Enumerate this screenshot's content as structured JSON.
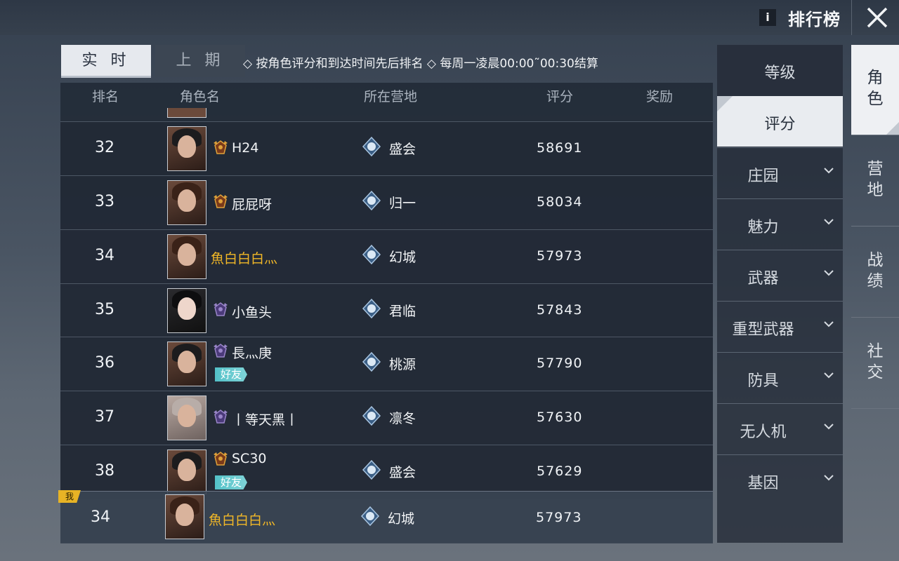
{
  "header": {
    "info_label": "i",
    "title": "排行榜",
    "close_icon": "close-icon"
  },
  "tabs": {
    "realtime": "实 时",
    "previous": "上 期"
  },
  "rule_text": "◇ 按角色评分和到达时间先后排名 ◇ 每周一凌晨00:00˜00:30结算",
  "table": {
    "columns": {
      "rank": "排名",
      "name": "角色名",
      "camp": "所在营地",
      "score": "评分",
      "reward": "奖励"
    },
    "rows": [
      {
        "rank": "32",
        "name": "H24",
        "name_color": "#f2f4f6",
        "camp": "盛会",
        "score": "58691",
        "friend": "",
        "badge": "gold-rank-badge-icon",
        "avatar": "male"
      },
      {
        "rank": "33",
        "name": "屁屁呀",
        "name_color": "#f2f4f6",
        "camp": "归一",
        "score": "58034",
        "friend": "",
        "badge": "gold-rank-badge-icon",
        "avatar": "female-brown"
      },
      {
        "rank": "34",
        "name": "魚白白白灬",
        "name_color": "#f2b827",
        "camp": "幻城",
        "score": "57973",
        "friend": "",
        "badge": "",
        "avatar": "female-brown"
      },
      {
        "rank": "35",
        "name": "小鱼头",
        "name_color": "#f2f4f6",
        "camp": "君临",
        "score": "57843",
        "friend": "",
        "badge": "purple-rank-badge-icon",
        "avatar": "female-dark"
      },
      {
        "rank": "36",
        "name": "長灬庚",
        "name_color": "#f2f4f6",
        "camp": "桃源",
        "score": "57790",
        "friend": "好友",
        "badge": "purple-wing-badge-icon",
        "avatar": "male"
      },
      {
        "rank": "37",
        "name": "丨等天黑丨",
        "name_color": "#f2f4f6",
        "camp": "凛冬",
        "score": "57630",
        "friend": "",
        "badge": "purple-wing-badge-icon",
        "avatar": "female-light"
      },
      {
        "rank": "38",
        "name": "SC30",
        "name_color": "#f2f4f6",
        "camp": "盛会",
        "score": "57629",
        "friend": "好友",
        "badge": "gold-rank-badge-icon",
        "avatar": "male"
      }
    ],
    "my_row": {
      "me_tag": "我",
      "rank": "34",
      "name": "魚白白白灬",
      "camp": "幻城",
      "score": "57973"
    }
  },
  "categories": [
    {
      "label": "等级",
      "has_dropdown": false,
      "active": false
    },
    {
      "label": "评分",
      "has_dropdown": false,
      "active": true
    },
    {
      "label": "庄园",
      "has_dropdown": true,
      "active": false
    },
    {
      "label": "魅力",
      "has_dropdown": true,
      "active": false
    },
    {
      "label": "武器",
      "has_dropdown": true,
      "active": false
    },
    {
      "label": "重型武器",
      "has_dropdown": true,
      "active": false
    },
    {
      "label": "防具",
      "has_dropdown": true,
      "active": false
    },
    {
      "label": "无人机",
      "has_dropdown": true,
      "active": false
    },
    {
      "label": "基因",
      "has_dropdown": true,
      "active": false
    }
  ],
  "side_tabs": [
    {
      "label1": "角",
      "label2": "色",
      "active": true
    },
    {
      "label1": "营",
      "label2": "地",
      "active": false
    },
    {
      "label1": "战",
      "label2": "绩",
      "active": false
    },
    {
      "label1": "社",
      "label2": "交",
      "active": false
    }
  ],
  "colors": {
    "gold_name": "#f2b827",
    "friend_tag": "#53c1c8",
    "me_tag": "#e7b325",
    "active_tab": "#e9ecf0"
  }
}
